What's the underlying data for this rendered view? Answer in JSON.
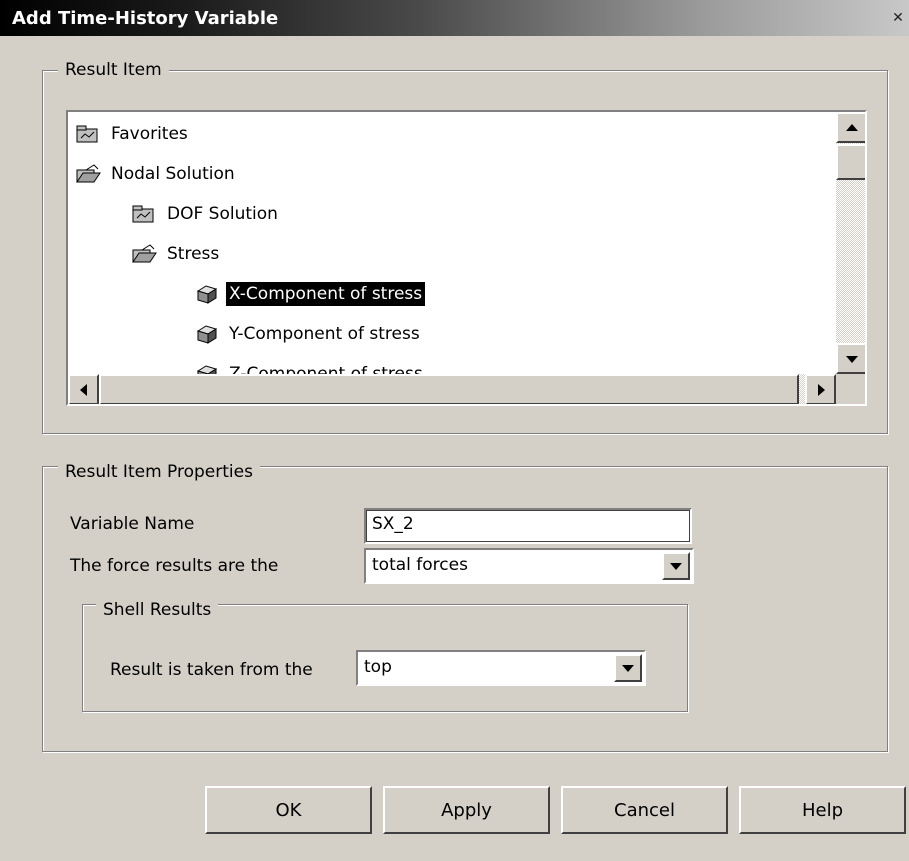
{
  "window": {
    "title": "Add Time-History Variable",
    "close_glyph": "✕"
  },
  "result_item": {
    "group_label": "Result Item",
    "tree": [
      {
        "label": "Favorites",
        "icon": "closed-folder-icon",
        "level": 0,
        "selected": false
      },
      {
        "label": "Nodal Solution",
        "icon": "open-folder-icon",
        "level": 0,
        "selected": false
      },
      {
        "label": "DOF Solution",
        "icon": "closed-folder-icon",
        "level": 1,
        "selected": false
      },
      {
        "label": "Stress",
        "icon": "open-folder-icon",
        "level": 1,
        "selected": false
      },
      {
        "label": "X-Component of stress",
        "icon": "cube-icon",
        "level": 2,
        "selected": true
      },
      {
        "label": "Y-Component of stress",
        "icon": "cube-icon",
        "level": 2,
        "selected": false
      },
      {
        "label": "Z-Component of stress",
        "icon": "cube-icon",
        "level": 2,
        "selected": false
      }
    ]
  },
  "properties": {
    "group_label": "Result Item Properties",
    "variable_name_label": "Variable Name",
    "variable_name_value": "SX_2",
    "force_label": "The force results are the",
    "force_value": "total forces",
    "shell": {
      "group_label": "Shell Results",
      "taken_label": "Result is taken from the",
      "taken_value": "top"
    }
  },
  "buttons": {
    "ok": "OK",
    "apply": "Apply",
    "cancel": "Cancel",
    "help": "Help"
  }
}
